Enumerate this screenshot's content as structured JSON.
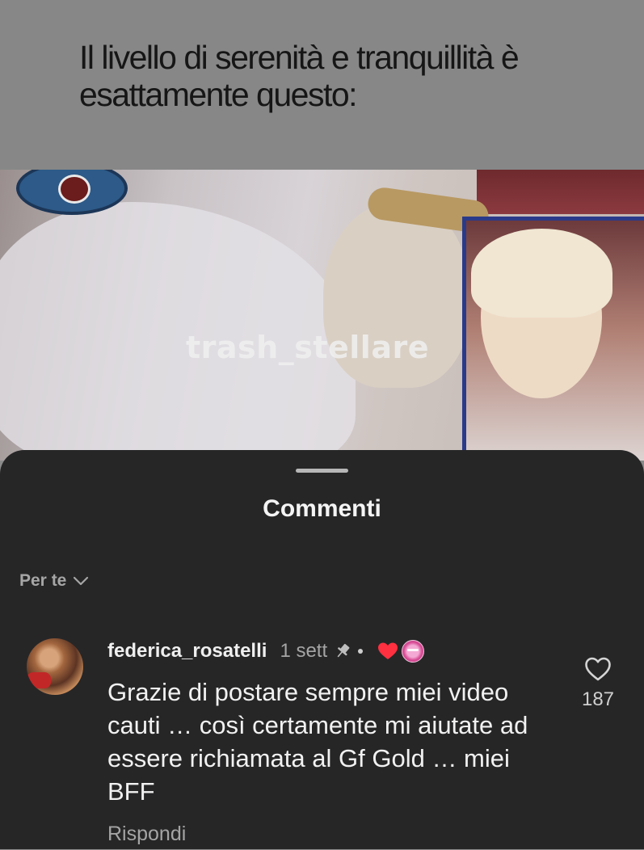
{
  "reel": {
    "caption": "Il livello di serenità e tranquillità è esattamente questo:",
    "watermark": "trash_stellare"
  },
  "comments_sheet": {
    "title": "Commenti",
    "sort_label": "Per te",
    "comment": {
      "username": "federica_rosatelli",
      "time": "1 sett",
      "text": "Grazie di postare sempre miei video cauti … così certamente mi aiutate ad essere richiamata al Gf Gold … miei BFF",
      "reply_label": "Rispondi",
      "like_count": "187",
      "icons": [
        "pin-icon",
        "author-heart-icon",
        "like-heart-icon",
        "chevron-down-icon"
      ]
    }
  },
  "colors": {
    "sheet_bg": "#262627",
    "author_heart": "#ff3040",
    "text_primary": "#f1f1f1",
    "text_secondary": "#a5a5a5"
  }
}
